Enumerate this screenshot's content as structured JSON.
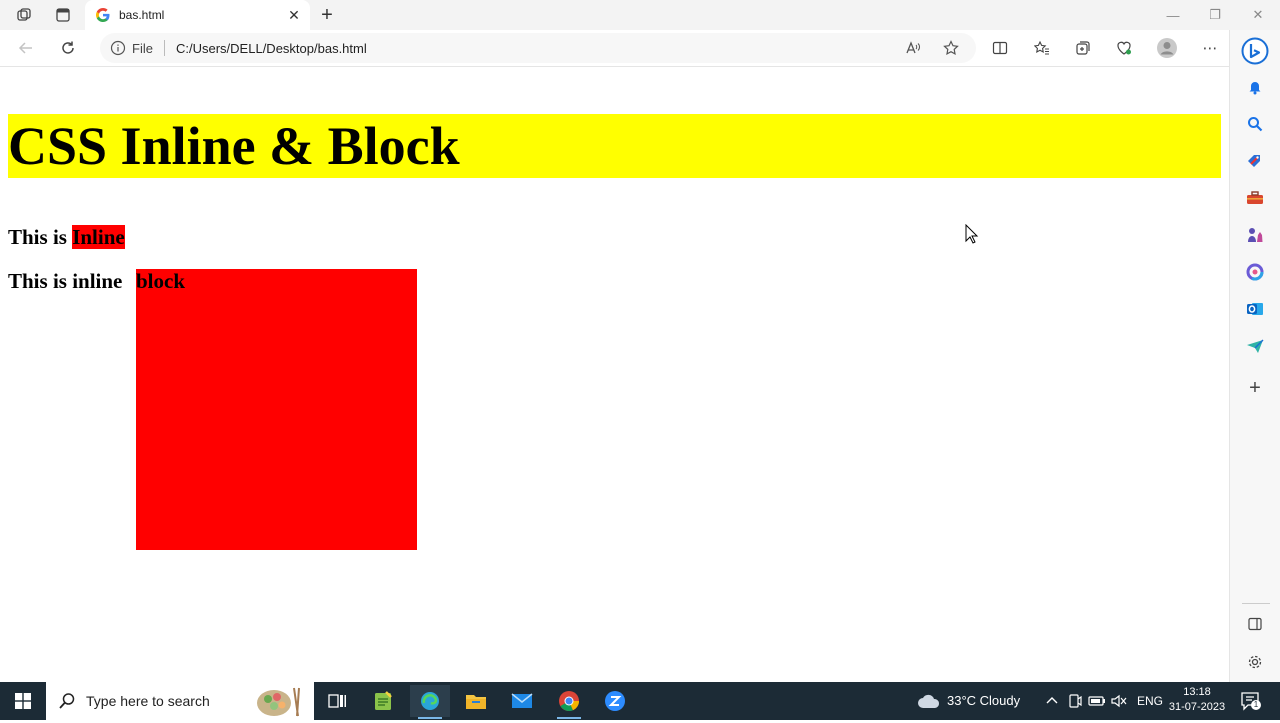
{
  "browser": {
    "tab": {
      "title": "bas.html"
    },
    "address": {
      "scheme_label": "File",
      "url": "C:/Users/DELL/Desktop/bas.html"
    }
  },
  "page": {
    "heading": "CSS Inline & Block",
    "line1": {
      "prefix": "This is ",
      "highlight": "Inline"
    },
    "line2": {
      "prefix": "This is inline ",
      "highlight": "block"
    }
  },
  "taskbar": {
    "search_placeholder": "Type here to search",
    "weather": "33°C  Cloudy",
    "language": "ENG",
    "time": "13:18",
    "date": "31-07-2023",
    "notification_count": "1"
  },
  "colors": {
    "heading_bg": "#ffff00",
    "highlight_bg": "#ff0000",
    "taskbar_bg": "#1c2b36"
  }
}
